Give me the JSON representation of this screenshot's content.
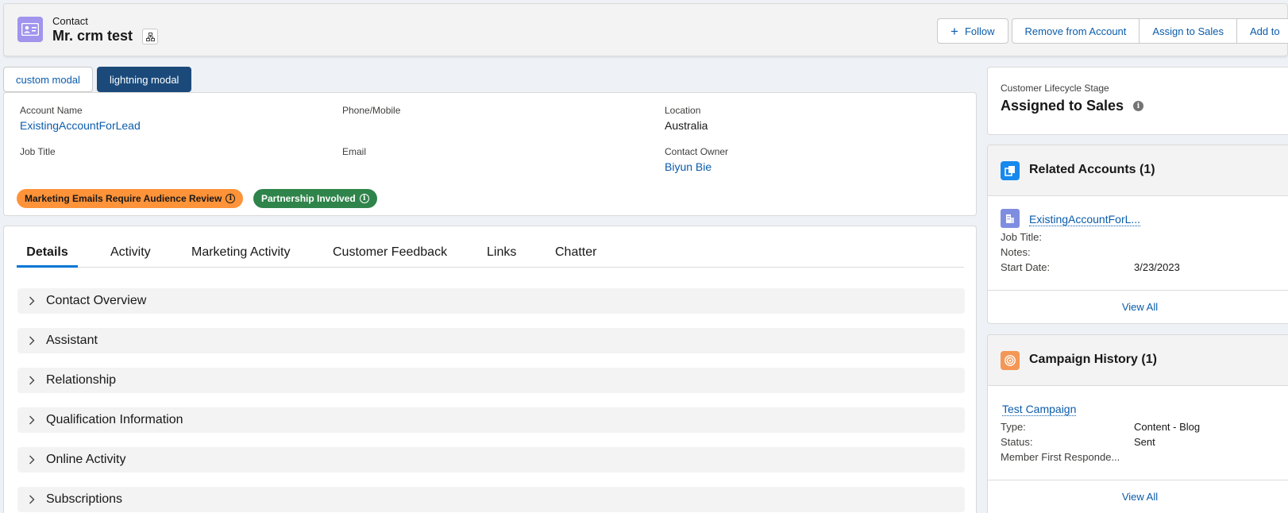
{
  "header": {
    "object_label": "Contact",
    "record_name": "Mr. crm test",
    "buttons": {
      "follow": "Follow",
      "remove_from_account": "Remove from Account",
      "assign_to_sales": "Assign to Sales",
      "add_to": "Add to"
    }
  },
  "modal_tabs": {
    "custom": "custom modal",
    "lightning": "lightning modal"
  },
  "highlights": {
    "account_name": {
      "label": "Account Name",
      "value": "ExistingAccountForLead"
    },
    "phone_mobile": {
      "label": "Phone/Mobile",
      "value": ""
    },
    "location": {
      "label": "Location",
      "value": "Australia"
    },
    "job_title": {
      "label": "Job Title",
      "value": ""
    },
    "email": {
      "label": "Email",
      "value": ""
    },
    "contact_owner": {
      "label": "Contact Owner",
      "value": "Biyun Bie"
    },
    "badges": {
      "marketing": "Marketing Emails Require Audience Review",
      "partnership": "Partnership Involved"
    }
  },
  "tabs": [
    "Details",
    "Activity",
    "Marketing Activity",
    "Customer Feedback",
    "Links",
    "Chatter"
  ],
  "sections": [
    "Contact Overview",
    "Assistant",
    "Relationship",
    "Qualification Information",
    "Online Activity",
    "Subscriptions"
  ],
  "lifecycle": {
    "label": "Customer Lifecycle Stage",
    "value": "Assigned to Sales"
  },
  "related_accounts": {
    "title": "Related Accounts (1)",
    "item": {
      "name": "ExistingAccountForL...",
      "job_title_label": "Job Title:",
      "job_title_value": "",
      "notes_label": "Notes:",
      "notes_value": "",
      "start_date_label": "Start Date:",
      "start_date_value": "3/23/2023"
    },
    "view_all": "View All"
  },
  "campaign_history": {
    "title": "Campaign History (1)",
    "item": {
      "name": "Test Campaign",
      "type_label": "Type:",
      "type_value": "Content - Blog",
      "status_label": "Status:",
      "status_value": "Sent",
      "member_label": "Member First Responde...",
      "member_value": ""
    },
    "view_all": "View All"
  },
  "colors": {
    "brand_blue": "#0b5cab",
    "active_tab": "#0176d3",
    "contact_icon": "#a094ed",
    "orange_badge": "#fe9339",
    "green_badge": "#2e844a",
    "lightning_tab": "#1b4a7a"
  }
}
